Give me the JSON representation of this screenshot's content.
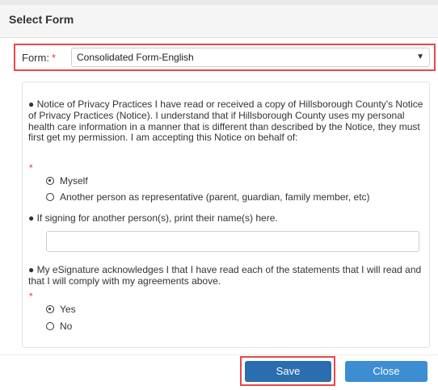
{
  "dialog": {
    "title": "Select Form"
  },
  "form_select": {
    "label": "Form:",
    "required_mark": "*",
    "value": "Consolidated Form-English",
    "caret": "▼"
  },
  "section1": {
    "text": "● Notice of Privacy Practices I have read or received a copy of Hillsborough County's Notice of Privacy Practices (Notice). I understand that if Hillsborough County uses my personal health care information in a manner that is different than described by the Notice, they must first get my permission. I am accepting this Notice on behalf of:",
    "required_mark": "*",
    "options": [
      {
        "label": "Myself",
        "checked": true
      },
      {
        "label": "Another person as representative (parent, guardian, family member, etc)",
        "checked": false
      }
    ]
  },
  "section2": {
    "text": "● If signing for another person(s), print their name(s) here.",
    "input_value": "",
    "input_placeholder": ""
  },
  "section3": {
    "text": "● My eSignature acknowledges I that I have read each of the statements that I will read and that I will comply with my agreements above.",
    "required_mark": "*",
    "options": [
      {
        "label": "Yes",
        "checked": true
      },
      {
        "label": "No",
        "checked": false
      }
    ]
  },
  "footer": {
    "save_label": "Save",
    "close_label": "Close"
  },
  "colors": {
    "highlight": "#e8474c",
    "save_button": "#2a6eaf",
    "close_button": "#3d8dd2",
    "required": "#e53935"
  },
  "icons": {
    "select_caret": "chevron-down-icon",
    "radio_checked": "radio-checked-icon",
    "radio_unchecked": "radio-unchecked-icon"
  }
}
